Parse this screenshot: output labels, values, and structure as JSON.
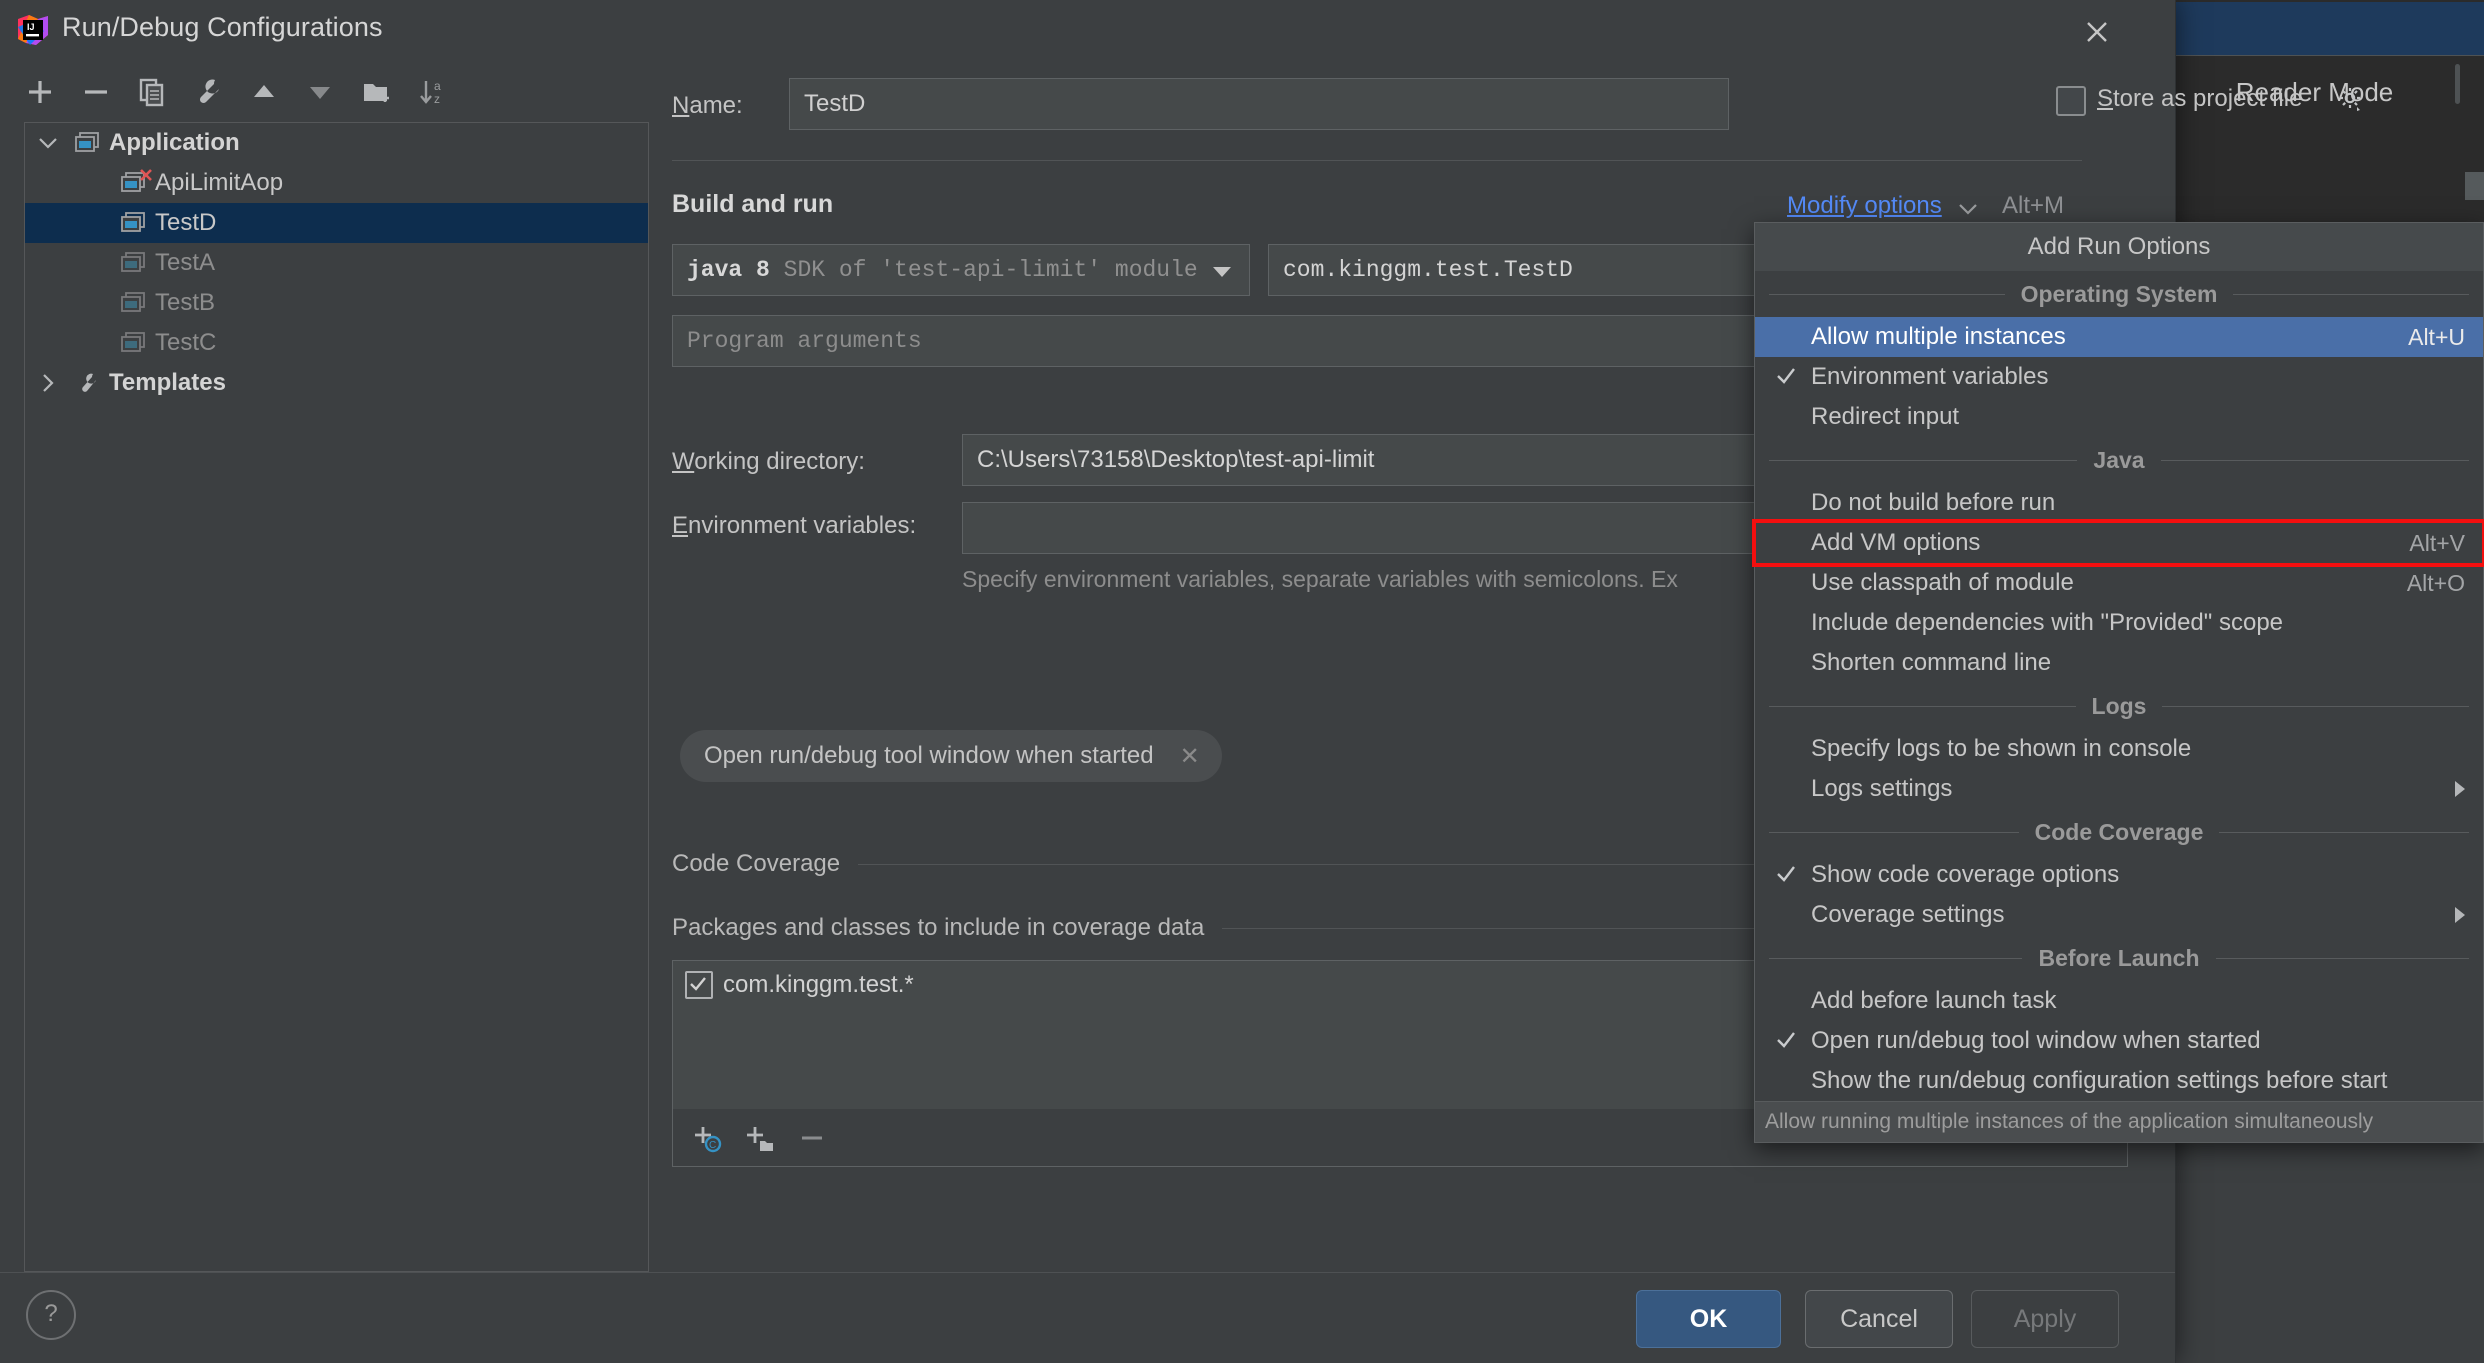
{
  "background": {
    "reader_mode_label": "Reader Mode"
  },
  "dialog": {
    "title": "Run/Debug Configurations",
    "logo_icon": "intellij-idea-logo",
    "close_icon": "close-icon",
    "help_icon": "help-icon",
    "help_label": "?"
  },
  "sidebar": {
    "toolbar": [
      {
        "name": "add-configuration-button",
        "icon": "plus-icon"
      },
      {
        "name": "remove-configuration-button",
        "icon": "minus-icon"
      },
      {
        "name": "copy-configuration-button",
        "icon": "copy-icon"
      },
      {
        "name": "edit-templates-button",
        "icon": "wrench-icon"
      },
      {
        "name": "move-up-button",
        "icon": "triangle-up-icon"
      },
      {
        "name": "move-down-button",
        "icon": "triangle-down-icon"
      },
      {
        "name": "new-folder-button",
        "icon": "folder-add-icon"
      },
      {
        "name": "sort-configurations-button",
        "icon": "sort-az-icon"
      }
    ],
    "tree": [
      {
        "label": "Application",
        "icon": "application-group-icon",
        "level": 0,
        "expanded": true,
        "bold": true,
        "selected": false,
        "dim": false,
        "error": false
      },
      {
        "label": "ApiLimitAop",
        "icon": "application-config-icon",
        "level": 1,
        "expanded": null,
        "bold": false,
        "selected": false,
        "dim": false,
        "error": true
      },
      {
        "label": "TestD",
        "icon": "application-config-icon",
        "level": 1,
        "expanded": null,
        "bold": false,
        "selected": true,
        "dim": false,
        "error": false
      },
      {
        "label": "TestA",
        "icon": "application-config-icon",
        "level": 1,
        "expanded": null,
        "bold": false,
        "selected": false,
        "dim": true,
        "error": false
      },
      {
        "label": "TestB",
        "icon": "application-config-icon",
        "level": 1,
        "expanded": null,
        "bold": false,
        "selected": false,
        "dim": true,
        "error": false
      },
      {
        "label": "TestC",
        "icon": "application-config-icon",
        "level": 1,
        "expanded": null,
        "bold": false,
        "selected": false,
        "dim": true,
        "error": false
      },
      {
        "label": "Templates",
        "icon": "wrench-icon",
        "level": 0,
        "expanded": false,
        "bold": true,
        "selected": false,
        "dim": false,
        "error": false
      }
    ]
  },
  "main": {
    "name_label": "Name:",
    "name_value": "TestD",
    "store_as_project_file_label": "Store as project file",
    "store_as_project_file_checked": false,
    "store_gear_icon": "gear-icon",
    "build_and_run_title": "Build and run",
    "modify_options_label": "Modify options",
    "modify_options_shortcut": "Alt+M",
    "modify_options_chevron": "chevron-down-icon",
    "sdk_value_bold": "java 8",
    "sdk_value_rest": "SDK of 'test-api-limit' module",
    "main_class_value": "com.kinggm.test.TestD",
    "program_arguments_placeholder": "Program arguments",
    "working_directory_label": "Working directory:",
    "working_directory_value": "C:\\Users\\73158\\Desktop\\test-api-limit",
    "environment_variables_label": "Environment variables:",
    "environment_variables_value": "",
    "environment_variables_hint": "Specify environment variables, separate variables with semicolons. Ex",
    "chip_label": "Open run/debug tool window when started",
    "chip_remove_icon": "close-small-icon",
    "code_coverage_title": "Code Coverage",
    "packages_section_title": "Packages and classes to include in coverage data",
    "coverage_entries": [
      {
        "label": "com.kinggm.test.*",
        "checked": true
      }
    ],
    "coverage_toolbar": [
      {
        "name": "add-class-button",
        "icon": "plus-class-icon"
      },
      {
        "name": "add-package-button",
        "icon": "plus-package-icon"
      },
      {
        "name": "remove-entry-button",
        "icon": "minus-icon"
      }
    ]
  },
  "menu": {
    "title": "Add Run Options",
    "status_text": "Allow running multiple instances of the application simultaneously",
    "sections": [
      {
        "caption": "Operating System",
        "items": [
          {
            "label": "Allow multiple instances",
            "shortcut": "Alt+U",
            "checked": false,
            "highlighted": true,
            "submenu": false,
            "annotated": false
          },
          {
            "label": "Environment variables",
            "shortcut": "",
            "checked": true,
            "highlighted": false,
            "submenu": false,
            "annotated": false
          },
          {
            "label": "Redirect input",
            "shortcut": "",
            "checked": false,
            "highlighted": false,
            "submenu": false,
            "annotated": false
          }
        ]
      },
      {
        "caption": "Java",
        "items": [
          {
            "label": "Do not build before run",
            "shortcut": "",
            "checked": false,
            "highlighted": false,
            "submenu": false,
            "annotated": false
          },
          {
            "label": "Add VM options",
            "shortcut": "Alt+V",
            "checked": false,
            "highlighted": false,
            "submenu": false,
            "annotated": true
          },
          {
            "label": "Use classpath of module",
            "shortcut": "Alt+O",
            "checked": false,
            "highlighted": false,
            "submenu": false,
            "annotated": false
          },
          {
            "label": "Include dependencies with \"Provided\" scope",
            "shortcut": "",
            "checked": false,
            "highlighted": false,
            "submenu": false,
            "annotated": false
          },
          {
            "label": "Shorten command line",
            "shortcut": "",
            "checked": false,
            "highlighted": false,
            "submenu": false,
            "annotated": false
          }
        ]
      },
      {
        "caption": "Logs",
        "items": [
          {
            "label": "Specify logs to be shown in console",
            "shortcut": "",
            "checked": false,
            "highlighted": false,
            "submenu": false,
            "annotated": false
          },
          {
            "label": "Logs settings",
            "shortcut": "",
            "checked": false,
            "highlighted": false,
            "submenu": true,
            "annotated": false
          }
        ]
      },
      {
        "caption": "Code Coverage",
        "items": [
          {
            "label": "Show code coverage options",
            "shortcut": "",
            "checked": true,
            "highlighted": false,
            "submenu": false,
            "annotated": false
          },
          {
            "label": "Coverage settings",
            "shortcut": "",
            "checked": false,
            "highlighted": false,
            "submenu": true,
            "annotated": false
          }
        ]
      },
      {
        "caption": "Before Launch",
        "items": [
          {
            "label": "Add before launch task",
            "shortcut": "",
            "checked": false,
            "highlighted": false,
            "submenu": false,
            "annotated": false
          },
          {
            "label": "Open run/debug tool window when started",
            "shortcut": "",
            "checked": true,
            "highlighted": false,
            "submenu": false,
            "annotated": false
          },
          {
            "label": "Show the run/debug configuration settings before start",
            "shortcut": "",
            "checked": false,
            "highlighted": false,
            "submenu": false,
            "annotated": false
          }
        ]
      }
    ]
  },
  "buttons": {
    "ok": "OK",
    "cancel": "Cancel",
    "apply": "Apply"
  },
  "colors": {
    "accent_blue": "#548af7",
    "selection_blue": "#0d2d4e",
    "menu_highlight": "#4a6fa8",
    "ok_button": "#365880",
    "annotation_red": "#f40f0f",
    "panel_bg": "#3c3f41",
    "field_bg": "#45494a"
  }
}
